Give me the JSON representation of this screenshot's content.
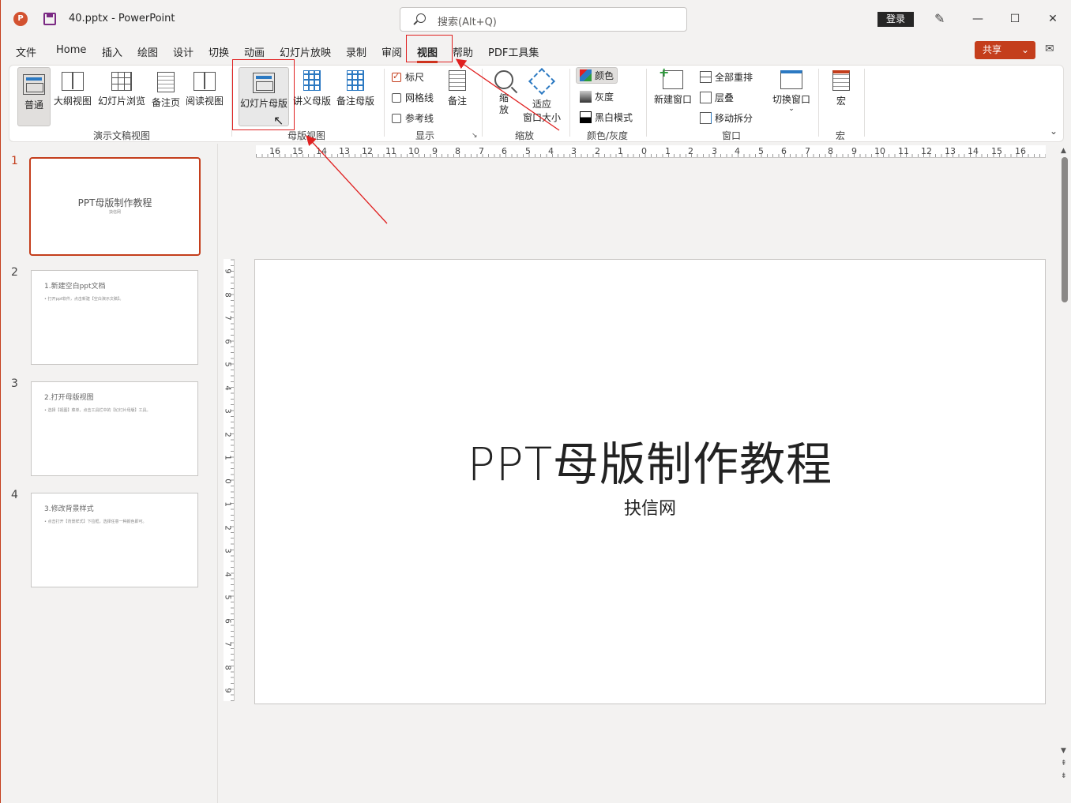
{
  "titlebar": {
    "app_logo": "P",
    "doc_title": "40.pptx  -  PowerPoint",
    "search_placeholder": "搜索(Alt+Q)",
    "login_label": "登录",
    "minimize": "—",
    "maximize": "☐",
    "close": "✕"
  },
  "tabs": [
    {
      "label": "文件"
    },
    {
      "label": "Home"
    },
    {
      "label": "插入"
    },
    {
      "label": "绘图"
    },
    {
      "label": "设计"
    },
    {
      "label": "切换"
    },
    {
      "label": "动画"
    },
    {
      "label": "幻灯片放映"
    },
    {
      "label": "录制"
    },
    {
      "label": "审阅"
    },
    {
      "label": "视图"
    },
    {
      "label": "帮助"
    },
    {
      "label": "PDF工具集"
    }
  ],
  "share": {
    "label": "共享",
    "caret": "⌄"
  },
  "ribbon": {
    "presentation_views": {
      "normal": "普通",
      "outline": "大纲视图",
      "sorter": "幻灯片浏览",
      "notes_page": "备注页",
      "reading": "阅读视图",
      "group": "演示文稿视图"
    },
    "master_views": {
      "slide_master": "幻灯片母版",
      "handout_master": "讲义母版",
      "notes_master": "备注母版",
      "group": "母版视图"
    },
    "show": {
      "ruler": "标尺",
      "gridlines": "网格线",
      "guides": "参考线",
      "notes": "备注",
      "group": "显示"
    },
    "zoom": {
      "zoom": "缩\n放",
      "fit_line1": "适应",
      "fit_line2": "窗口大小",
      "group": "缩放"
    },
    "color": {
      "color": "颜色",
      "grayscale": "灰度",
      "bw": "黑白模式",
      "group": "颜色/灰度"
    },
    "window": {
      "new_window": "新建窗口",
      "arrange_all": "全部重排",
      "cascade": "层叠",
      "move_split": "移动拆分",
      "switch": "切换窗口",
      "group": "窗口"
    },
    "macros": {
      "macros": "宏",
      "group": "宏"
    }
  },
  "ruler_h": [
    "16",
    "15",
    "14",
    "13",
    "12",
    "11",
    "10",
    "9",
    "8",
    "7",
    "6",
    "5",
    "4",
    "3",
    "2",
    "1",
    "0",
    "1",
    "2",
    "3",
    "4",
    "5",
    "6",
    "7",
    "8",
    "9",
    "10",
    "11",
    "12",
    "13",
    "14",
    "15",
    "16"
  ],
  "ruler_v": [
    "9",
    "8",
    "7",
    "6",
    "5",
    "4",
    "3",
    "2",
    "1",
    "0",
    "1",
    "2",
    "3",
    "4",
    "5",
    "6",
    "7",
    "8",
    "9"
  ],
  "thumbnails": [
    {
      "num": "1",
      "title": "PPT母版制作教程",
      "subtitle": "抉信网"
    },
    {
      "num": "2",
      "heading": "1.新建空白ppt文档",
      "body": "• 打开ppt软件，点击新建【空白演示文稿】。"
    },
    {
      "num": "3",
      "heading": "2.打开母版视图",
      "body": "• 选择【视图】菜单，点击工具栏中的【幻灯片母版】工具。"
    },
    {
      "num": "4",
      "heading": "3.修改背景样式",
      "body": "• 点击打开【背景样式】下拉框，选择任意一种颜色即可。"
    }
  ],
  "slide": {
    "title": "PPT母版制作教程",
    "subtitle": "抉信网"
  },
  "colors": {
    "accent": "#c43e1c",
    "annotation": "#e02020"
  }
}
